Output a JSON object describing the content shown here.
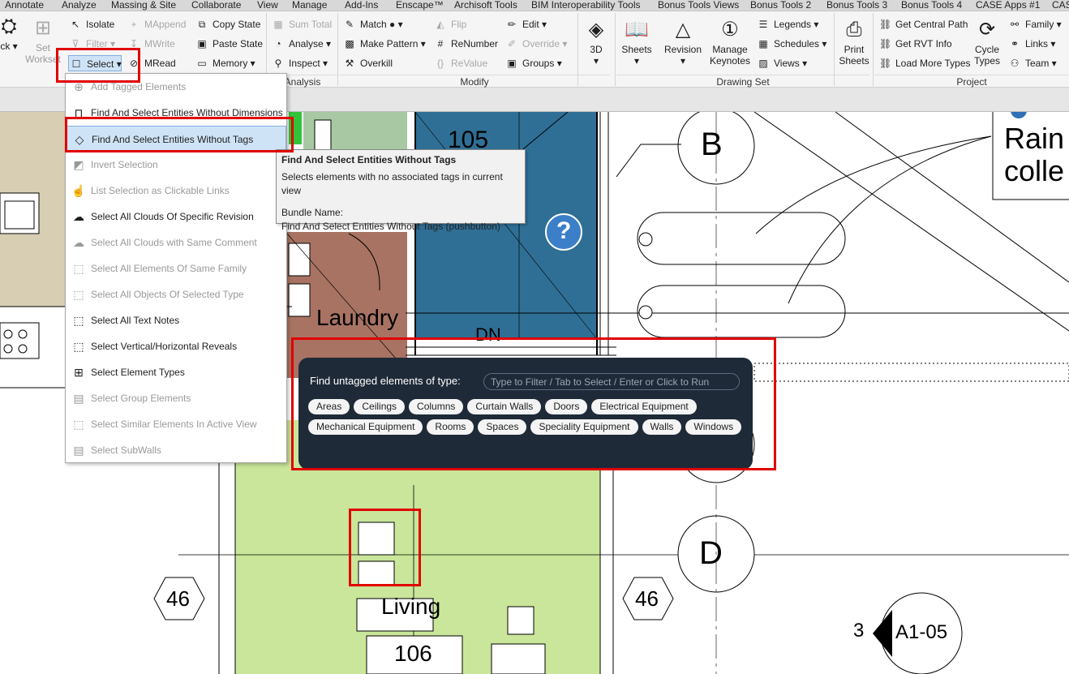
{
  "tabs": [
    "Annotate",
    "Analyze",
    "Massing & Site",
    "Collaborate",
    "View",
    "Manage",
    "Add-Ins",
    "Enscape™",
    "Archisoft Tools",
    "BIM Interoperability Tools",
    "Bonus Tools Views",
    "Bonus Tools 2",
    "Bonus Tools 3",
    "Bonus Tools 4",
    "CASE Apps #1",
    "CAS"
  ],
  "ribbon": {
    "left_big": {
      "lock_label": "ck",
      "lock_caret": "▾",
      "set_worksets_line1": "Set",
      "set_worksets_line2": "Workset"
    },
    "col1": {
      "isolate": "Isolate",
      "filter": "Filter",
      "select": "Select"
    },
    "col2": {
      "mappend": "MAppend",
      "mwrite": "MWrite",
      "mread": "MRead"
    },
    "col3": {
      "copy_state": "Copy State",
      "paste_state": "Paste State",
      "memory": "Memory"
    },
    "col4": {
      "sum_total": "Sum Total",
      "analyse": "Analyse",
      "inspect": "Inspect"
    },
    "col5": {
      "match": "Match",
      "make_pattern": "Make Pattern",
      "overkill": "Overkill"
    },
    "col6": {
      "flip": "Flip",
      "renumber": "ReNumber",
      "revalue": "ReValue"
    },
    "col7": {
      "edit": "Edit",
      "override": "Override",
      "groups": "Groups"
    },
    "big_3d": "3D",
    "big_sheets": "Sheets",
    "big_revision": "Revision",
    "big_manage_line1": "Manage",
    "big_manage_line2": "Keynotes",
    "col8": {
      "legends": "Legends",
      "schedules": "Schedules",
      "views": "Views"
    },
    "big_print_line1": "Print",
    "big_print_line2": "Sheets",
    "col9": {
      "get_central": "Get Central Path",
      "get_rvt": "Get RVT Info",
      "load_types": "Load More Types"
    },
    "big_cycle_line1": "Cycle",
    "big_cycle_line2": "Types",
    "col10": {
      "family": "Family",
      "links": "Links",
      "team": "Team"
    },
    "groups": {
      "analysis": "Analysis",
      "modify": "Modify",
      "drawing_set": "Drawing Set",
      "project": "Project"
    }
  },
  "dropdown": {
    "items": [
      {
        "label": "Add Tagged Elements",
        "icon": "⊕",
        "enabled": false
      },
      {
        "label": "Find And Select Entities Without Dimensions",
        "icon": "⊓",
        "enabled": true
      },
      {
        "label": "Find And Select Entities Without Tags",
        "icon": "◇",
        "enabled": true,
        "highlighted": true
      },
      {
        "label": "Invert Selection",
        "icon": "◩",
        "enabled": false
      },
      {
        "label": "List Selection as Clickable Links",
        "icon": "☝",
        "enabled": false
      },
      {
        "label": "Select All Clouds Of Specific Revision",
        "icon": "☁",
        "enabled": true
      },
      {
        "label": "Select All Clouds with Same Comment",
        "icon": "☁",
        "enabled": false
      },
      {
        "label": "Select All Elements Of Same Family",
        "icon": "⬚",
        "enabled": false
      },
      {
        "label": "Select All Objects Of Selected Type",
        "icon": "⬚",
        "enabled": false
      },
      {
        "label": "Select All Text Notes",
        "icon": "⬚",
        "enabled": true
      },
      {
        "label": "Select Vertical/Horizontal Reveals",
        "icon": "⬚",
        "enabled": true
      },
      {
        "label": "Select Element Types",
        "icon": "⊞",
        "enabled": true
      },
      {
        "label": "Select Group Elements",
        "icon": "▤",
        "enabled": false
      },
      {
        "label": "Select Similar Elements In Active View",
        "icon": "⬚",
        "enabled": false
      },
      {
        "label": "Select SubWalls",
        "icon": "▤",
        "enabled": false
      }
    ]
  },
  "tooltip": {
    "title": "Find And Select Entities Without Tags",
    "description": "Selects elements with no associated tags in current view",
    "bundle_label": "Bundle Name:",
    "bundle_value": "Find And Select Entities Without Tags (pushbutton)"
  },
  "palette": {
    "label": "Find untagged elements of type:",
    "placeholder": "Type to Filter / Tab to Select / Enter or Click to Run",
    "chips": [
      "Areas",
      "Ceilings",
      "Columns",
      "Curtain Walls",
      "Doors",
      "Electrical Equipment",
      "Mechanical Equipment",
      "Rooms",
      "Spaces",
      "Speciality Equipment",
      "Walls",
      "Windows"
    ]
  },
  "drawing": {
    "room_105": "105",
    "laundry": "Laundry",
    "dn": "DN",
    "grid_b": "B",
    "grid_d": "D",
    "rain_line1": "Rain",
    "rain_line2": "colle",
    "living": "Living",
    "room_106": "106",
    "level_left": "46",
    "level_right": "46",
    "section_num": "3",
    "section_sheet": "A1-05",
    "help_glyph": "?"
  },
  "colors": {
    "highlight_red": "#e00000",
    "palette_bg": "#1f2a38",
    "stair_blue": "#2f6f95",
    "laundry_brown": "#a87363",
    "living_green": "#c9e69a"
  }
}
